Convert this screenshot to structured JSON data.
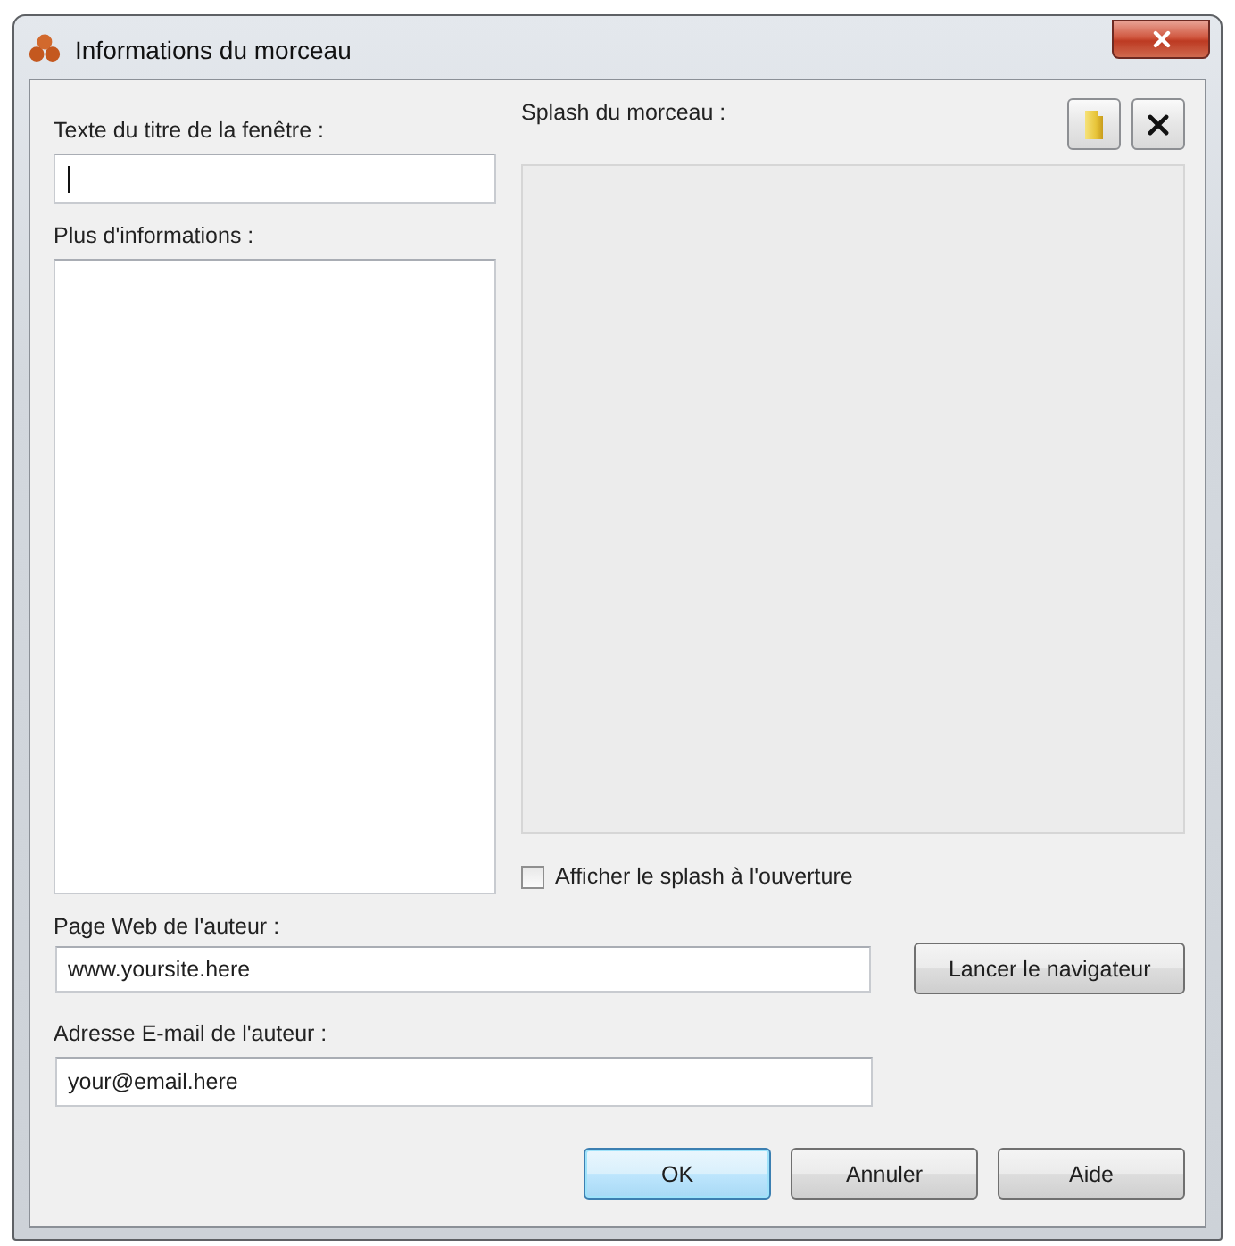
{
  "window": {
    "title": "Informations du morceau"
  },
  "title_field": {
    "label": "Texte du titre de la fenêtre :",
    "focused": true
  },
  "more_info": {
    "label": "Plus d'informations :"
  },
  "splash": {
    "label": "Splash du morceau :",
    "show_on_open": {
      "label": "Afficher le splash à l'ouverture",
      "checked": false
    }
  },
  "web_page": {
    "label": "Page Web de l'auteur :",
    "value": "www.yoursite.here",
    "button": "Lancer le navigateur"
  },
  "email": {
    "label": "Adresse E-mail de l'auteur :",
    "value": "your@email.here"
  },
  "buttons": [
    {
      "label": "OK",
      "default": true
    },
    {
      "label": "Annuler",
      "default": false
    },
    {
      "label": "Aide",
      "default": false
    }
  ]
}
